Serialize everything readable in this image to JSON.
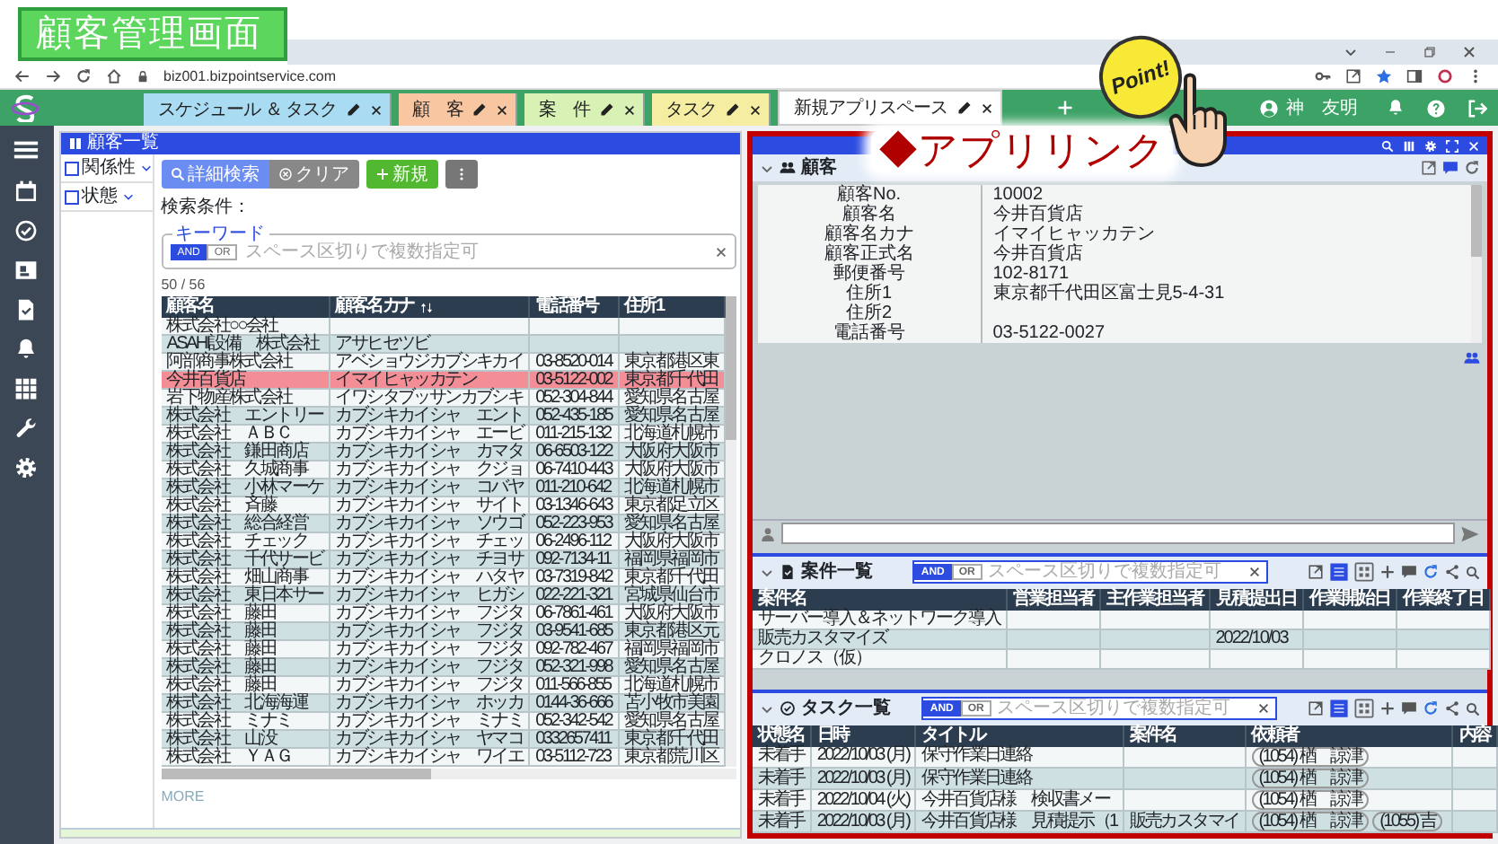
{
  "banner": {
    "title": "顧客管理画面"
  },
  "browser": {
    "url": "biz001.bizpointservice.com"
  },
  "app_tabs": [
    {
      "label": "スケジュール ＆ タスク",
      "color": "#a9dcf2",
      "selected": false
    },
    {
      "label": "顧　客",
      "color": "#f8c6a0",
      "selected": false
    },
    {
      "label": "案　件",
      "color": "#d8f1b4",
      "selected": false
    },
    {
      "label": "タスク",
      "color": "#f5eea2",
      "selected": false
    },
    {
      "label": "新規アプリスペース",
      "color": "#ffffff",
      "selected": true
    }
  ],
  "user": {
    "name": "神　友明"
  },
  "sidebar": {
    "items": [
      {
        "kind": "menu"
      },
      {
        "kind": "calendar"
      },
      {
        "kind": "task"
      },
      {
        "kind": "contact"
      },
      {
        "kind": "document"
      },
      {
        "kind": "bell"
      },
      {
        "kind": "apps"
      },
      {
        "kind": "wrench"
      },
      {
        "kind": "settings"
      }
    ]
  },
  "customer_list": {
    "title": "顧客一覧",
    "filters": [
      {
        "label": "関係性",
        "checked": false
      },
      {
        "label": "状態",
        "checked": false
      }
    ],
    "buttons": [
      {
        "kind": "search",
        "label": "詳細検索"
      },
      {
        "kind": "clear",
        "label": "クリア"
      },
      {
        "kind": "new",
        "label": "新規"
      },
      {
        "kind": "more"
      }
    ],
    "conditions_label": "検索条件：",
    "keyword": {
      "legend": "キーワード",
      "modes": [
        {
          "label": "AND",
          "selected": true
        },
        {
          "label": "OR",
          "selected": false
        }
      ],
      "placeholder": "スペース区切りで複数指定可"
    },
    "count": "50 / 56",
    "columns": [
      {
        "label": "顧客名",
        "sorted": false
      },
      {
        "label": "顧客名カナ",
        "sorted": true
      },
      {
        "label": "電話番号",
        "sorted": false
      },
      {
        "label": "住所1",
        "sorted": false
      }
    ],
    "rows": [
      {
        "cells": [
          "株式会社○○会社",
          null,
          null,
          null
        ],
        "selected": false
      },
      {
        "cells": [
          "ASAHI設備　株式会社",
          "アサヒセツビ",
          null,
          null
        ],
        "selected": false
      },
      {
        "cells": [
          "阿部商事株式会社",
          "アベショウジカブシキカイ",
          "03-8520-014",
          "東京都港区東"
        ],
        "selected": false
      },
      {
        "cells": [
          "今井百貨店",
          "イマイヒャッカテン",
          "03-5122-002",
          "東京都千代田"
        ],
        "selected": true
      },
      {
        "cells": [
          "岩下物産株式会社",
          "イワシタブッサンカブシキ",
          "052-304-844",
          "愛知県名古屋"
        ],
        "selected": false
      },
      {
        "cells": [
          "株式会社　エントリー",
          "カブシキカイシャ　エント",
          "052-435-185",
          "愛知県名古屋"
        ],
        "selected": false
      },
      {
        "cells": [
          "株式会社　ＡＢＣ",
          "カブシキカイシャ　エービ",
          "011-215-132",
          "北海道札幌市"
        ],
        "selected": false
      },
      {
        "cells": [
          "株式会社　鎌田商店",
          "カブシキカイシャ　カマタ",
          "06-6503-122",
          "大阪府大阪市"
        ],
        "selected": false
      },
      {
        "cells": [
          "株式会社　久城商事",
          "カブシキカイシャ　クジョ",
          "06-7410-443",
          "大阪府大阪市"
        ],
        "selected": false
      },
      {
        "cells": [
          "株式会社　小林マーケ",
          "カブシキカイシャ　コバヤ",
          "011-210-642",
          "北海道札幌市"
        ],
        "selected": false
      },
      {
        "cells": [
          "株式会社　斉藤",
          "カブシキカイシャ　サイト",
          "03-1346-643",
          "東京都足立区"
        ],
        "selected": false
      },
      {
        "cells": [
          "株式会社　総合経営",
          "カブシキカイシャ　ソウゴ",
          "052-223-953",
          "愛知県名古屋"
        ],
        "selected": false
      },
      {
        "cells": [
          "株式会社　チェック",
          "カブシキカイシャ　チェッ",
          "06-2496-112",
          "大阪府大阪市"
        ],
        "selected": false
      },
      {
        "cells": [
          "株式会社　千代サービ",
          "カブシキカイシャ　チヨサ",
          "092-7134-11",
          "福岡県福岡市"
        ],
        "selected": false
      },
      {
        "cells": [
          "株式会社　畑山商事",
          "カブシキカイシャ　ハタヤ",
          "03-7319-842",
          "東京都千代田"
        ],
        "selected": false
      },
      {
        "cells": [
          "株式会社　東日本サー",
          "カブシキカイシャ　ヒガシ",
          "022-221-321",
          "宮城県仙台市"
        ],
        "selected": false
      },
      {
        "cells": [
          "株式会社　藤田",
          "カブシキカイシャ　フジタ",
          "06-7861-461",
          "大阪府大阪市"
        ],
        "selected": false
      },
      {
        "cells": [
          "株式会社　藤田",
          "カブシキカイシャ　フジタ",
          "03-9541-685",
          "東京都港区元"
        ],
        "selected": false
      },
      {
        "cells": [
          "株式会社　藤田",
          "カブシキカイシャ　フジタ",
          "092-782-467",
          "福岡県福岡市"
        ],
        "selected": false
      },
      {
        "cells": [
          "株式会社　藤田",
          "カブシキカイシャ　フジタ",
          "052-321-998",
          "愛知県名古屋"
        ],
        "selected": false
      },
      {
        "cells": [
          "株式会社　藤田",
          "カブシキカイシャ　フジタ",
          "011-566-855",
          "北海道札幌市"
        ],
        "selected": false
      },
      {
        "cells": [
          "株式会社　北海海運",
          "カブシキカイシャ　ホッカ",
          "0144-36-666",
          "苫小牧市美園"
        ],
        "selected": false
      },
      {
        "cells": [
          "株式会社　ミナミ",
          "カブシキカイシャ　ミナミ",
          "052-342-542",
          "愛知県名古屋"
        ],
        "selected": false
      },
      {
        "cells": [
          "株式会社　山没",
          "カブシキカイシャ　ヤマコ",
          "0332657411",
          "東京都千代田"
        ],
        "selected": false
      },
      {
        "cells": [
          "株式会社　ＹＡＧ",
          "カブシキカイシャ　ワイエ",
          "03-5112-723",
          "東京都荒川区"
        ],
        "selected": false
      }
    ],
    "more": "MORE"
  },
  "callout": {
    "text": "◆アプリリンク"
  },
  "point_badge": {
    "text": "Point!"
  },
  "app_link": {
    "customer": {
      "title": "顧客",
      "fields": [
        {
          "label": "顧客No.",
          "value": "10002"
        },
        {
          "label": "顧客名",
          "value": "今井百貨店"
        },
        {
          "label": "顧客名カナ",
          "value": "イマイヒャッカテン"
        },
        {
          "label": "顧客正式名",
          "value": "今井百貨店"
        },
        {
          "label": "郵便番号",
          "value": "102-8171"
        },
        {
          "label": "住所1",
          "value": "東京都千代田区富士見5-4-31"
        },
        {
          "label": "住所2"
        },
        {
          "label": "電話番号",
          "value": "03-5122-0027"
        }
      ]
    },
    "cases": {
      "title": "案件一覧",
      "modes": [
        {
          "label": "AND",
          "selected": true
        },
        {
          "label": "OR",
          "selected": false
        }
      ],
      "placeholder": "スペース区切りで複数指定可",
      "views": [
        {
          "kind": "list",
          "selected": true
        },
        {
          "kind": "grid",
          "selected": false
        }
      ],
      "columns": [
        "案件名",
        "営業担当者",
        "主作業担当者",
        "見積提出日",
        "作業開始日",
        "作業終了日"
      ],
      "rows": [
        [
          "サーバー導入＆ネットワーク導入",
          null,
          null,
          null,
          null,
          null
        ],
        [
          "販売カスタマイズ",
          null,
          null,
          "2022/10/03",
          null,
          null
        ],
        [
          "クロノス（仮）",
          null,
          null,
          null,
          null,
          null
        ]
      ]
    },
    "tasks": {
      "title": "タスク一覧",
      "modes": [
        {
          "label": "AND",
          "selected": true
        },
        {
          "label": "OR",
          "selected": false
        }
      ],
      "placeholder": "スペース区切りで複数指定可",
      "views": [
        {
          "kind": "list",
          "selected": true
        },
        {
          "kind": "grid",
          "selected": false
        }
      ],
      "columns": [
        "状態名",
        "日時",
        "タイトル",
        "案件名",
        "依頼者",
        "内容"
      ],
      "rows": [
        {
          "status": "未着手",
          "date": "2022/10/03 (月)",
          "title": "保守作業日連絡",
          "requesters": [
            "(1054) 楢　諒津"
          ]
        },
        {
          "status": "未着手",
          "date": "2022/10/03 (月)",
          "title": "保守作業日連絡",
          "requesters": [
            "(1054) 楢　諒津"
          ]
        },
        {
          "status": "未着手",
          "date": "2022/10/04 (火)",
          "title": "今井百貨店様　検収書メー",
          "requesters": [
            "(1054) 楢　諒津"
          ]
        },
        {
          "status": "未着手",
          "date": "2022/10/03 (月)",
          "title": "今井百貨店様　見積提示（1",
          "case": "販売カスタマイ",
          "requesters": [
            "(1054) 楢　諒津",
            "(1055) 吉"
          ]
        }
      ]
    }
  }
}
